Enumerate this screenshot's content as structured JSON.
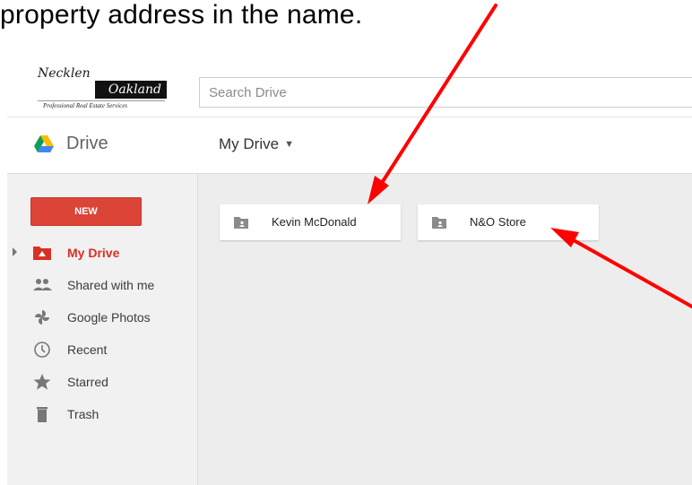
{
  "caption": {
    "text": "property address in the name."
  },
  "logo": {
    "line1": "Necklen",
    "line2": "Oakland",
    "tagline": "Professional Real Estate Services"
  },
  "search": {
    "placeholder": "Search Drive"
  },
  "drivebar": {
    "title": "Drive",
    "location": "My Drive"
  },
  "sidebar": {
    "new_label": "NEW",
    "items": [
      {
        "label": "My Drive",
        "icon": "my-drive-icon",
        "active": true
      },
      {
        "label": "Shared with me",
        "icon": "shared-people-icon"
      },
      {
        "label": "Google Photos",
        "icon": "photos-pinwheel-icon"
      },
      {
        "label": "Recent",
        "icon": "clock-icon"
      },
      {
        "label": "Starred",
        "icon": "star-icon"
      },
      {
        "label": "Trash",
        "icon": "trash-icon"
      }
    ]
  },
  "folders": [
    {
      "name": "Kevin McDonald",
      "icon": "shared-folder-icon"
    },
    {
      "name": "N&O Store",
      "icon": "shared-folder-icon"
    }
  ],
  "colors": {
    "accent_red": "#db4437",
    "active_text": "#d93025",
    "arrow_red": "#ff0000",
    "sidebar_bg": "#f1f1f1",
    "content_bg": "#ededed"
  }
}
